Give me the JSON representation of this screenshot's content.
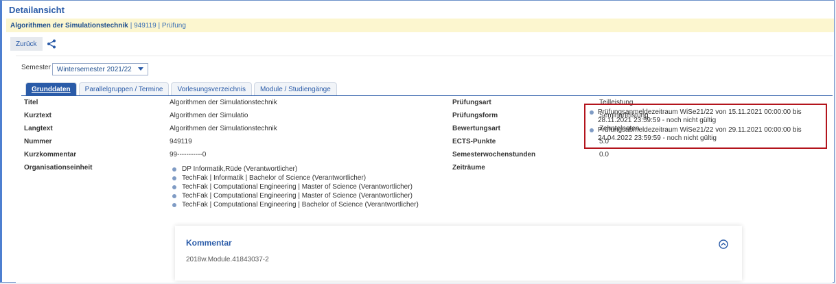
{
  "header": {
    "title": "Detailansicht"
  },
  "breadcrumb": {
    "course": "Algorithmen der Simulationstechnik",
    "rest": "| 949119 | Prüfung"
  },
  "toolbar": {
    "back_label": "Zurück",
    "share_icon": "share-icon"
  },
  "semester": {
    "label": "Semester",
    "selected": "Wintersemester 2021/22"
  },
  "tabs": [
    {
      "label": "Grunddaten",
      "active": true
    },
    {
      "label": "Parallelgruppen / Termine",
      "active": false
    },
    {
      "label": "Vorlesungsverzeichnis",
      "active": false
    },
    {
      "label": "Module / Studiengänge",
      "active": false
    }
  ],
  "left_fields": [
    {
      "label": "Titel",
      "value": "Algorithmen der Simulationstechnik"
    },
    {
      "label": "Kurztext",
      "value": "Algorithmen der Simulatio"
    },
    {
      "label": "Langtext",
      "value": "Algorithmen der Simulationstechnik"
    },
    {
      "label": "Nummer",
      "value": "949119"
    },
    {
      "label": "Kurzkommentar",
      "value": "99-----------0"
    }
  ],
  "org": {
    "label": "Organisationseinheit",
    "items": [
      "DP Informatik,Rüde (Verantwortlicher)",
      "TechFak | Informatik | Bachelor of Science (Verantwortlicher)",
      "TechFak | Computational Engineering | Master of Science (Verantwortlicher)",
      "TechFak | Computational Engineering | Master of Science (Verantwortlicher)",
      "TechFak | Computational Engineering | Bachelor of Science (Verantwortlicher)"
    ]
  },
  "right_fields": [
    {
      "label": "Prüfungsart",
      "value": "Teilleistung"
    },
    {
      "label": "Prüfungsform",
      "value": "Seminarleistung"
    },
    {
      "label": "Bewertungsart",
      "value": "Zehntelnoten"
    },
    {
      "label": "ECTS-Punkte",
      "value": "5.0"
    },
    {
      "label": "Semesterwochenstunden",
      "value": "0.0"
    }
  ],
  "zeitraeume": {
    "label": "Zeiträume",
    "items": [
      "Prüfungsanmeldezeitraum WiSe21/22 von 15.11.2021 00:00:00 bis 28.11.2021 23:59:59 - noch nicht gültig",
      "Prüfungsabmeldezeitraum WiSe21/22 von 29.11.2021 00:00:00 bis 24.04.2022 23:59:59 - noch nicht gültig"
    ]
  },
  "kommentar": {
    "title": "Kommentar",
    "value": "2018w.Module.41843037-2"
  },
  "colors": {
    "accent": "#2a5ba8",
    "highlight_box": "#b3141c",
    "crumb_bg": "#fcf6cf"
  }
}
